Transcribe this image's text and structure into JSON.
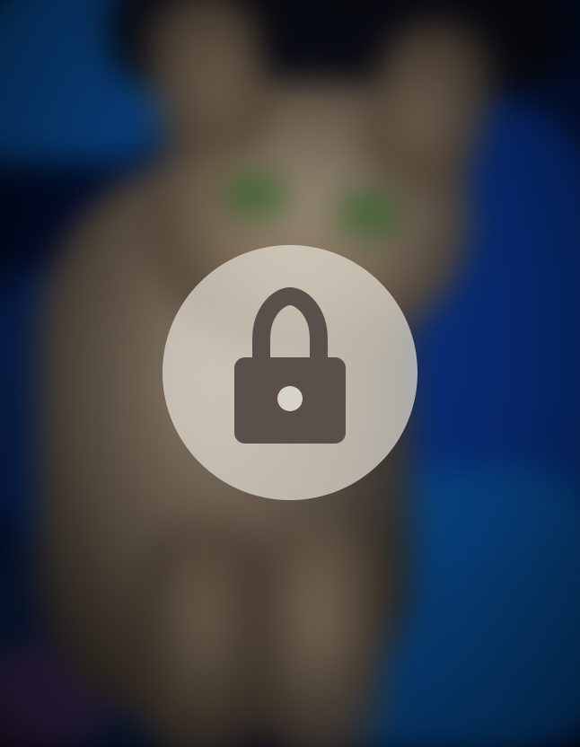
{
  "overlay": {
    "icon": "lock-icon",
    "colors": {
      "circle_fill": "#E6E1D6",
      "icon_fill": "#5A4F4B"
    }
  }
}
